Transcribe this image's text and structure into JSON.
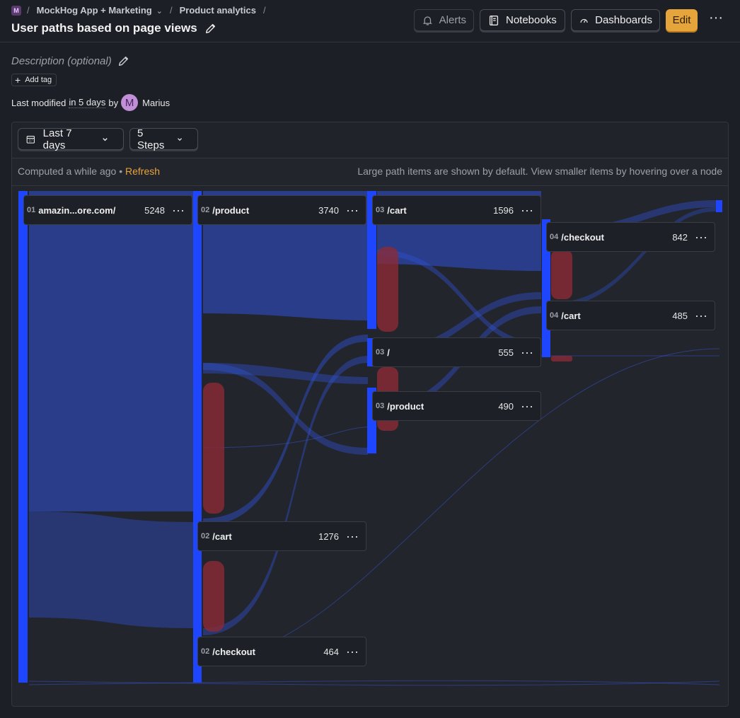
{
  "breadcrumb": {
    "project_badge": "M",
    "project": "MockHog App + Marketing",
    "section": "Product analytics"
  },
  "page": {
    "title": "User paths based on page views",
    "description_placeholder": "Description (optional)",
    "add_tag": "Add tag",
    "modified_prefix": "Last modified",
    "modified_when": "in 5 days",
    "modified_by": "by",
    "author_initial": "M",
    "author": "Marius"
  },
  "toolbar": {
    "alerts": "Alerts",
    "notebooks": "Notebooks",
    "dashboards": "Dashboards",
    "edit": "Edit"
  },
  "filters": {
    "date_range": "Last 7 days",
    "steps": "5 Steps"
  },
  "status": {
    "computed": "Computed a while ago",
    "bullet": "•",
    "refresh": "Refresh",
    "hint": "Large path items are shown by default. View smaller items by hovering over a node"
  },
  "colors": {
    "accent": "#e6a53a",
    "node_bar": "#1f46ff",
    "flow": "#2b4ed6",
    "dropoff": "#8b2b34"
  },
  "chart_data": {
    "type": "sankey",
    "nodes": [
      {
        "step": "01",
        "path": "amazin...ore.com/",
        "count": 5248
      },
      {
        "step": "02",
        "path": "/product",
        "count": 3740
      },
      {
        "step": "02",
        "path": "/cart",
        "count": 1276
      },
      {
        "step": "02",
        "path": "/checkout",
        "count": 464
      },
      {
        "step": "03",
        "path": "/cart",
        "count": 1596
      },
      {
        "step": "03",
        "path": "/",
        "count": 555
      },
      {
        "step": "03",
        "path": "/product",
        "count": 490
      },
      {
        "step": "04",
        "path": "/checkout",
        "count": 842
      },
      {
        "step": "04",
        "path": "/cart",
        "count": 485
      }
    ]
  }
}
